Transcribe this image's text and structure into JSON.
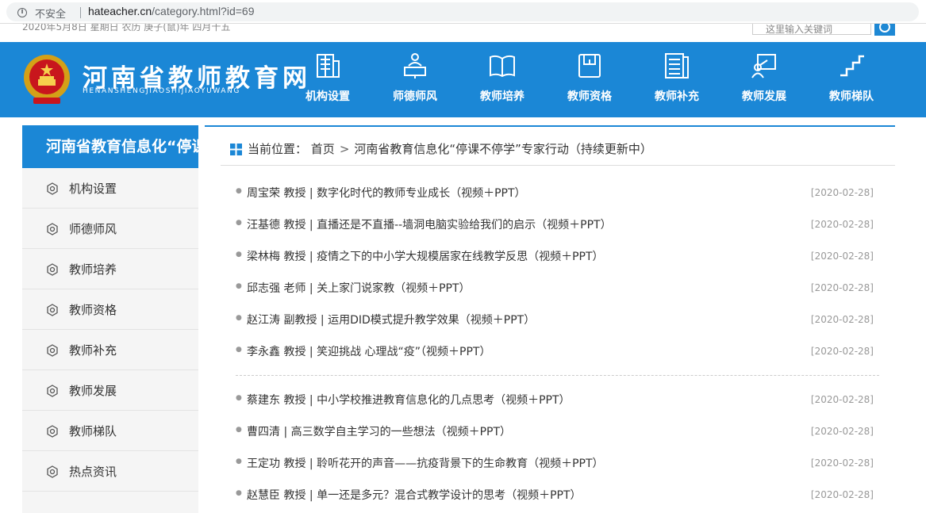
{
  "browser": {
    "security_label": "不安全",
    "url_host": "hateacher.cn",
    "url_path": "/category.html?id=69"
  },
  "topbar": {
    "date_text": "2020年5月8日 星期日 农历 庚子(鼠)年 四月十五",
    "search_placeholder": "这里输入关键词"
  },
  "header": {
    "site_title": "河南省教师教育网",
    "site_subtitle": "HENANSHENGJIAOSHIJIAOYUWANG",
    "nav": [
      {
        "label": "机构设置",
        "icon": "building-icon"
      },
      {
        "label": "师德师风",
        "icon": "podium-icon"
      },
      {
        "label": "教师培养",
        "icon": "book-icon"
      },
      {
        "label": "教师资格",
        "icon": "certificate-icon"
      },
      {
        "label": "教师补充",
        "icon": "document-icon"
      },
      {
        "label": "教师发展",
        "icon": "presenter-icon"
      },
      {
        "label": "教师梯队",
        "icon": "stairs-icon"
      }
    ]
  },
  "sidebar": {
    "title": "河南省教育信息化“停课不停学”专家行动（持续更新中）",
    "items": [
      {
        "label": "机构设置"
      },
      {
        "label": "师德师风"
      },
      {
        "label": "教师培养"
      },
      {
        "label": "教师资格"
      },
      {
        "label": "教师补充"
      },
      {
        "label": "教师发展"
      },
      {
        "label": "教师梯队"
      },
      {
        "label": "热点资讯"
      }
    ]
  },
  "breadcrumb": {
    "prefix": "当前位置：",
    "home": "首页",
    "sep": ">",
    "current": "河南省教育信息化“停课不停学”专家行动（持续更新中）"
  },
  "news": [
    {
      "title": "周宝荣 教授 | 数字化时代的教师专业成长（视频＋PPT）",
      "date": "[2020-02-28]"
    },
    {
      "title": "汪基德 教授 | 直播还是不直播--墙洞电脑实验给我们的启示（视频＋PPT）",
      "date": "[2020-02-28]"
    },
    {
      "title": "梁林梅 教授 | 疫情之下的中小学大规模居家在线教学反思（视频＋PPT）",
      "date": "[2020-02-28]"
    },
    {
      "title": "邱志强 老师 | 关上家门说家教（视频＋PPT）",
      "date": "[2020-02-28]"
    },
    {
      "title": "赵江涛 副教授 | 运用DID模式提升教学效果（视频＋PPT）",
      "date": "[2020-02-28]"
    },
    {
      "title": "李永鑫 教授 | 笑迎挑战 心理战“疫”（视频＋PPT）",
      "date": "[2020-02-28]"
    },
    {
      "title": "蔡建东 教授 | 中小学校推进教育信息化的几点思考（视频＋PPT）",
      "date": "[2020-02-28]"
    },
    {
      "title": "曹四清 | 高三数学自主学习的一些想法（视频＋PPT）",
      "date": "[2020-02-28]"
    },
    {
      "title": "王定功 教授 | 聆听花开的声音——抗疫背景下的生命教育（视频＋PPT）",
      "date": "[2020-02-28]"
    },
    {
      "title": "赵慧臣 教授 | 单一还是多元？混合式教学设计的思考（视频＋PPT）",
      "date": "[2020-02-28]"
    }
  ]
}
